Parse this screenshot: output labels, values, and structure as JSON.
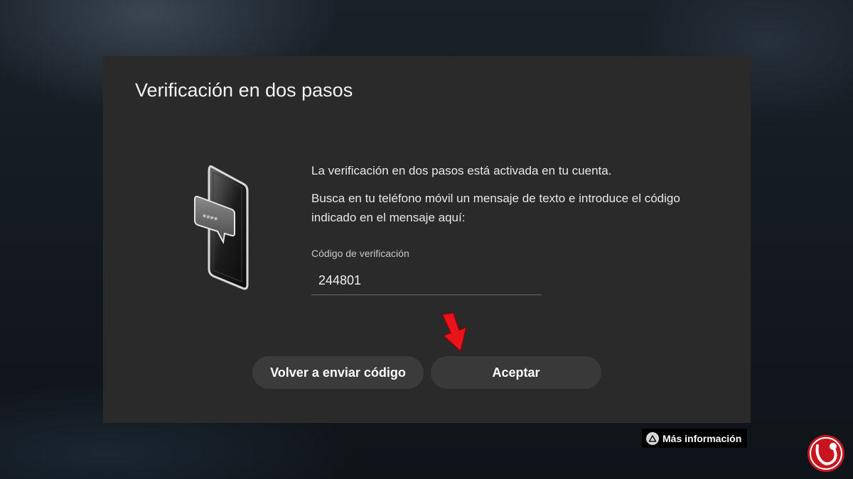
{
  "dialog": {
    "title": "Verificación en dos pasos",
    "message_1": "La verificación en dos pasos está activada en tu cuenta.",
    "message_2": "Busca en tu teléfono móvil un mensaje de texto e introduce el código indicado en el mensaje aquí:",
    "code_label": "Código de verificación",
    "code_value": "244801",
    "resend_button": "Volver a enviar código",
    "accept_button": "Aceptar"
  },
  "illustration": {
    "bubble_text": "****"
  },
  "footer": {
    "more_info": "Más información"
  },
  "colors": {
    "dialog_bg": "#2a2a2a",
    "button_bg": "#3b3b3b",
    "arrow": "#e8141a"
  },
  "icons": {
    "illustration": "phone-sms-code-icon",
    "info": "triangle-button-icon",
    "pointer": "red-arrow-icon",
    "watermark": "logo"
  }
}
